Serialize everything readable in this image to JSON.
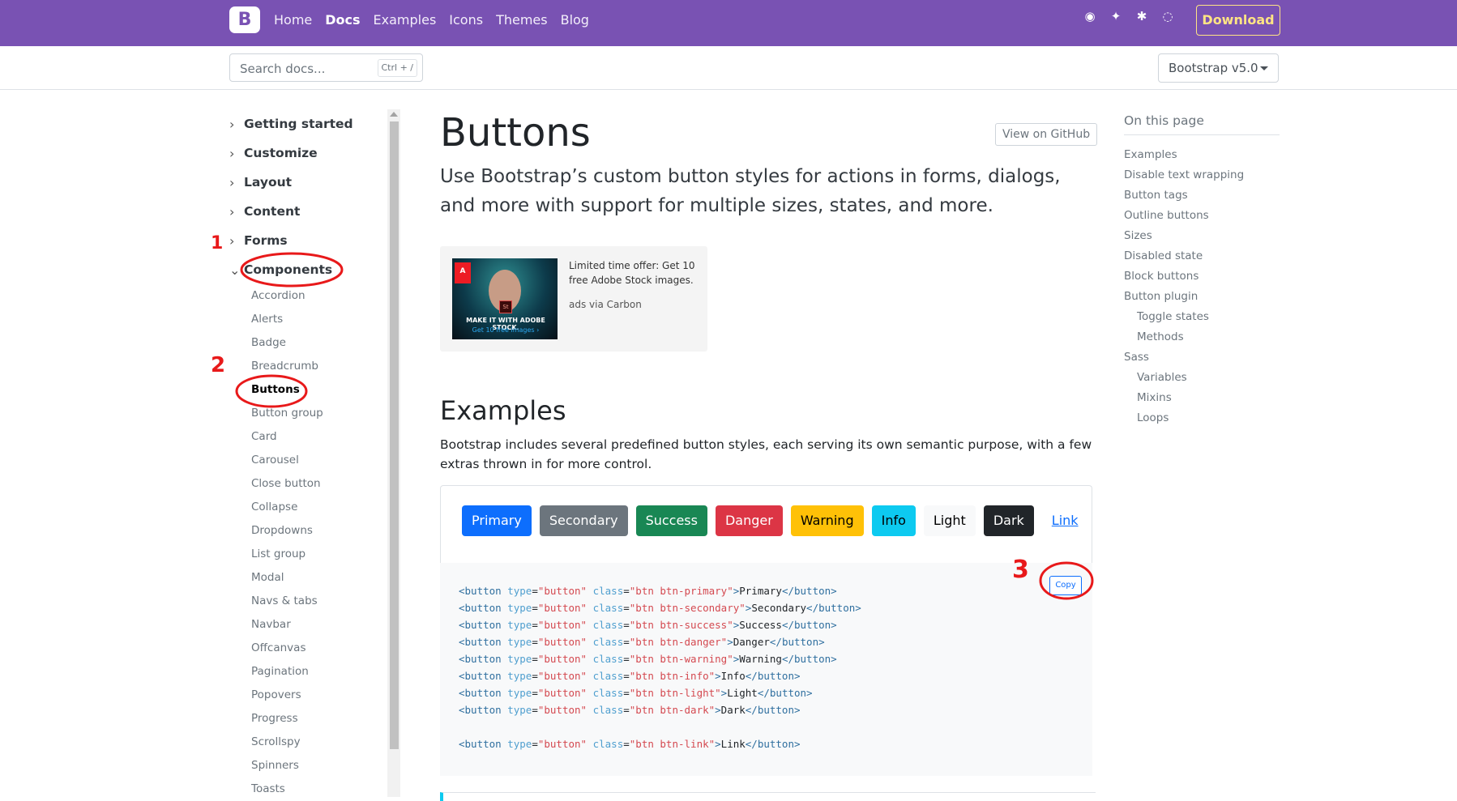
{
  "topbar": {
    "brand_letter": "B",
    "nav": [
      {
        "label": "Home",
        "active": false
      },
      {
        "label": "Docs",
        "active": true
      },
      {
        "label": "Examples",
        "active": false
      },
      {
        "label": "Icons",
        "active": false
      },
      {
        "label": "Themes",
        "active": false
      },
      {
        "label": "Blog",
        "active": false
      }
    ],
    "social_icons": [
      "github-icon",
      "twitter-icon",
      "slack-icon",
      "opencollective-icon"
    ],
    "download_label": "Download",
    "accent_color": "#7952b3",
    "download_color": "#ffe484"
  },
  "subbar": {
    "search_placeholder": "Search docs...",
    "search_shortcut": "Ctrl + /",
    "version_label": "Bootstrap v5.0"
  },
  "sidebar": {
    "sections": [
      {
        "label": "Getting started"
      },
      {
        "label": "Customize"
      },
      {
        "label": "Layout"
      },
      {
        "label": "Content"
      },
      {
        "label": "Forms"
      },
      {
        "label": "Components"
      }
    ],
    "components": [
      "Accordion",
      "Alerts",
      "Badge",
      "Breadcrumb",
      "Buttons",
      "Button group",
      "Card",
      "Carousel",
      "Close button",
      "Collapse",
      "Dropdowns",
      "List group",
      "Modal",
      "Navs & tabs",
      "Navbar",
      "Offcanvas",
      "Pagination",
      "Popovers",
      "Progress",
      "Scrollspy",
      "Spinners",
      "Toasts"
    ],
    "active_item": "Buttons"
  },
  "main": {
    "title": "Buttons",
    "github_label": "View on GitHub",
    "lead": "Use Bootstrap’s custom button styles for actions in forms, dialogs, and more with support for multiple sizes, states, and more.",
    "ad": {
      "image_logo": "A",
      "image_badge": "St",
      "image_line1": "MAKE IT WITH ADOBE STOCK.",
      "image_line2": "Get 10 free images ›",
      "text": "Limited time offer: Get 10 free Adobe Stock images.",
      "via": "ads via Carbon"
    },
    "examples_heading": "Examples",
    "examples_text": "Bootstrap includes several predefined button styles, each serving its own semantic purpose, with a few extras thrown in for more control.",
    "buttons": [
      {
        "label": "Primary",
        "cls": "primary"
      },
      {
        "label": "Secondary",
        "cls": "secondary"
      },
      {
        "label": "Success",
        "cls": "success"
      },
      {
        "label": "Danger",
        "cls": "danger"
      },
      {
        "label": "Warning",
        "cls": "warning"
      },
      {
        "label": "Info",
        "cls": "info"
      },
      {
        "label": "Light",
        "cls": "light"
      },
      {
        "label": "Dark",
        "cls": "dark"
      },
      {
        "label": "Link",
        "cls": "link"
      }
    ],
    "code_lines": [
      {
        "cls": "btn btn-primary",
        "text": "Primary"
      },
      {
        "cls": "btn btn-secondary",
        "text": "Secondary"
      },
      {
        "cls": "btn btn-success",
        "text": "Success"
      },
      {
        "cls": "btn btn-danger",
        "text": "Danger"
      },
      {
        "cls": "btn btn-warning",
        "text": "Warning"
      },
      {
        "cls": "btn btn-info",
        "text": "Info"
      },
      {
        "cls": "btn btn-light",
        "text": "Light"
      },
      {
        "cls": "btn btn-dark",
        "text": "Dark"
      },
      {
        "cls": "",
        "text": ""
      },
      {
        "cls": "btn btn-link",
        "text": "Link"
      }
    ],
    "copy_label": "Copy"
  },
  "toc": {
    "title": "On this page",
    "items": [
      {
        "label": "Examples",
        "indent": false
      },
      {
        "label": "Disable text wrapping",
        "indent": false
      },
      {
        "label": "Button tags",
        "indent": false
      },
      {
        "label": "Outline buttons",
        "indent": false
      },
      {
        "label": "Sizes",
        "indent": false
      },
      {
        "label": "Disabled state",
        "indent": false
      },
      {
        "label": "Block buttons",
        "indent": false
      },
      {
        "label": "Button plugin",
        "indent": false
      },
      {
        "label": "Toggle states",
        "indent": true
      },
      {
        "label": "Methods",
        "indent": true
      },
      {
        "label": "Sass",
        "indent": false
      },
      {
        "label": "Variables",
        "indent": true
      },
      {
        "label": "Mixins",
        "indent": true
      },
      {
        "label": "Loops",
        "indent": true
      }
    ]
  },
  "annotations": {
    "labels": [
      "1",
      "2",
      "3"
    ],
    "color": "#e8191a"
  }
}
